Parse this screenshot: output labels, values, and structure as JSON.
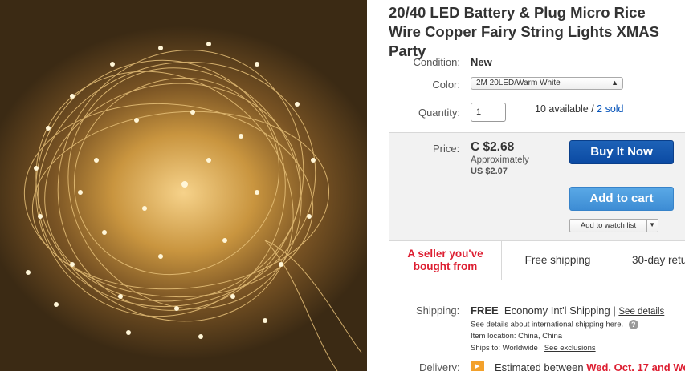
{
  "listing": {
    "title": "20/40 LED Battery & Plug Micro Rice Wire Copper Fairy String Lights XMAS Party",
    "condition_label": "Condition:",
    "condition_value": "New",
    "color_label": "Color:",
    "color_selected": "2M 20LED/Warm White",
    "quantity_label": "Quantity:",
    "quantity_value": "1",
    "available_text": "10 available /",
    "sold_text": "2 sold"
  },
  "buybox": {
    "price_label": "Price:",
    "price": "C $2.68",
    "approx_label": "Approximately",
    "usd_price": "US $2.07",
    "buy_now_label": "Buy It Now",
    "add_to_cart_label": "Add to cart",
    "watch_label": "Add to watch list",
    "promo": [
      "A seller you've bought from",
      "Free shipping",
      "30-day retu"
    ]
  },
  "shipping": {
    "label": "Shipping:",
    "free": "FREE",
    "service": "Economy Int'l Shipping",
    "separator": "|",
    "details_link": "See details",
    "line1": "See details about international shipping here.",
    "location": "Item location:  China, China",
    "ships_to": "Ships to:  Worldwide",
    "exclusions_link": "See exclusions"
  },
  "delivery": {
    "label": "Delivery:",
    "text": "Estimated between",
    "date": "Wed. Oct. 17 and We"
  },
  "colors": {
    "buy_now": "#0b4aa3",
    "add_to_cart": "#3d8cd4",
    "alert_red": "#dd1e31",
    "link_blue": "#0654ba"
  },
  "icons": {
    "help": "question-circle-icon",
    "delivery": "flag-icon",
    "dropdown": "chevron-down-icon"
  }
}
